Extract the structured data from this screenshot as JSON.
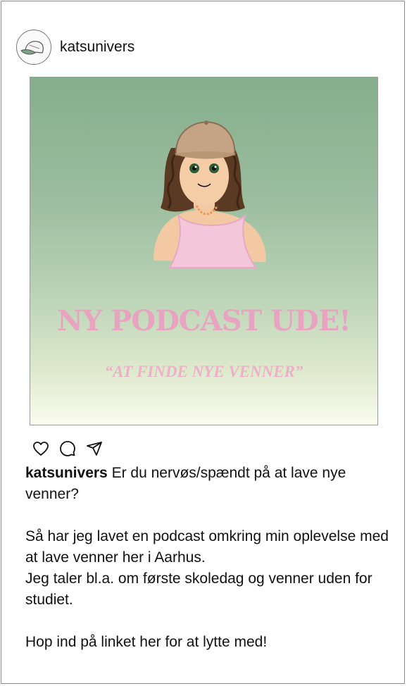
{
  "post": {
    "username": "katsunivers",
    "image": {
      "title": "NY PODCAST UDE!",
      "subtitle": "“AT FINDE NYE VENNER”"
    },
    "actions": [
      {
        "icon": "heart-icon"
      },
      {
        "icon": "comment-icon"
      },
      {
        "icon": "share-icon"
      }
    ],
    "caption": {
      "username": "katsunivers",
      "intro": "Er du nervøs/spændt på at lave nye venner?",
      "line1": "Så har jeg lavet en podcast omkring min oplevelse med at lave venner her i Aarhus.",
      "line2": "Jeg taler bl.a. om første skoledag og venner uden for studiet.",
      "line3": "Hop ind på linket her for at lytte med!"
    }
  },
  "colors": {
    "bg_top": "#84ae8c",
    "bg_bottom": "#fbfcf0",
    "title_pink": "#e8a3c0"
  }
}
